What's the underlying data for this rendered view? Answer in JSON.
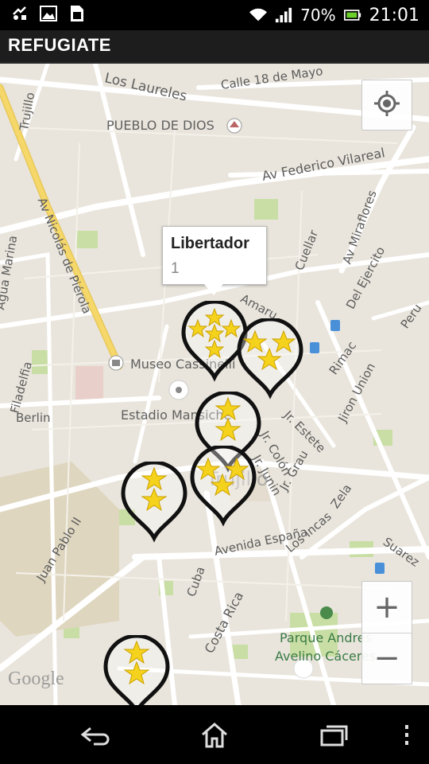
{
  "status_bar": {
    "battery_percent": "70%",
    "time": "21:01",
    "icons": [
      "usb-debug-icon",
      "image-icon",
      "sim-icon",
      "wifi-icon",
      "signal-icon",
      "battery-icon"
    ]
  },
  "app": {
    "title": "REFUGIATE"
  },
  "map": {
    "labels": {
      "los_laureles": "Los Laureles",
      "calle_18": "Calle 18 de Mayo",
      "trujillo": "Trujillo",
      "pueblo_de_dios": "PUEBLO DE DIOS",
      "federico": "Av Federico Vilareal",
      "nicolas": "Av Nicolás de Piérola",
      "miraflores": "Av Miraflores",
      "agua_marina": "Agua Marina",
      "cuellar": "Cuellar",
      "del_ejercito": "Del Ejercito",
      "amaru": "Amaru",
      "peru": "Peru",
      "filadelfia": "Filadelfia",
      "museo": "Museo Cassinelli",
      "rimac": "Rimac",
      "jiron_union": "Jiron Union",
      "jr_estete": "Jr. Estete",
      "berlin": "Berlin",
      "estadio": "Estadio Mansiche",
      "jr_colon": "Jr. Colón",
      "jr_junin": "Jr. Junin",
      "jr_grau": "Jr. Grau",
      "trujillo_center": "Trujillo",
      "zela": "Zela",
      "juan_pablo": "Juan Pablo II",
      "espana": "Avenida España",
      "los_incas": "Los Incas",
      "suarez": "Suarez",
      "cuba": "Cuba",
      "costa_rica": "Costa Rica",
      "parque": "Parque Andres",
      "parque2": "Avelino Cáceres"
    },
    "attribution": "Google",
    "zoom_in": "+",
    "zoom_out": "−"
  },
  "info_window": {
    "title": "Libertador",
    "value": "1"
  },
  "markers": [
    {
      "stars": 5
    },
    {
      "stars": 3
    },
    {
      "stars": 2
    },
    {
      "stars": 3
    },
    {
      "stars": 2
    },
    {
      "stars": 2
    }
  ],
  "colors": {
    "map_bg": "#e9e5dc",
    "road": "#ffffff",
    "highway": "#f6d76a",
    "park": "#c8dea4",
    "star": "#f5d21c"
  }
}
